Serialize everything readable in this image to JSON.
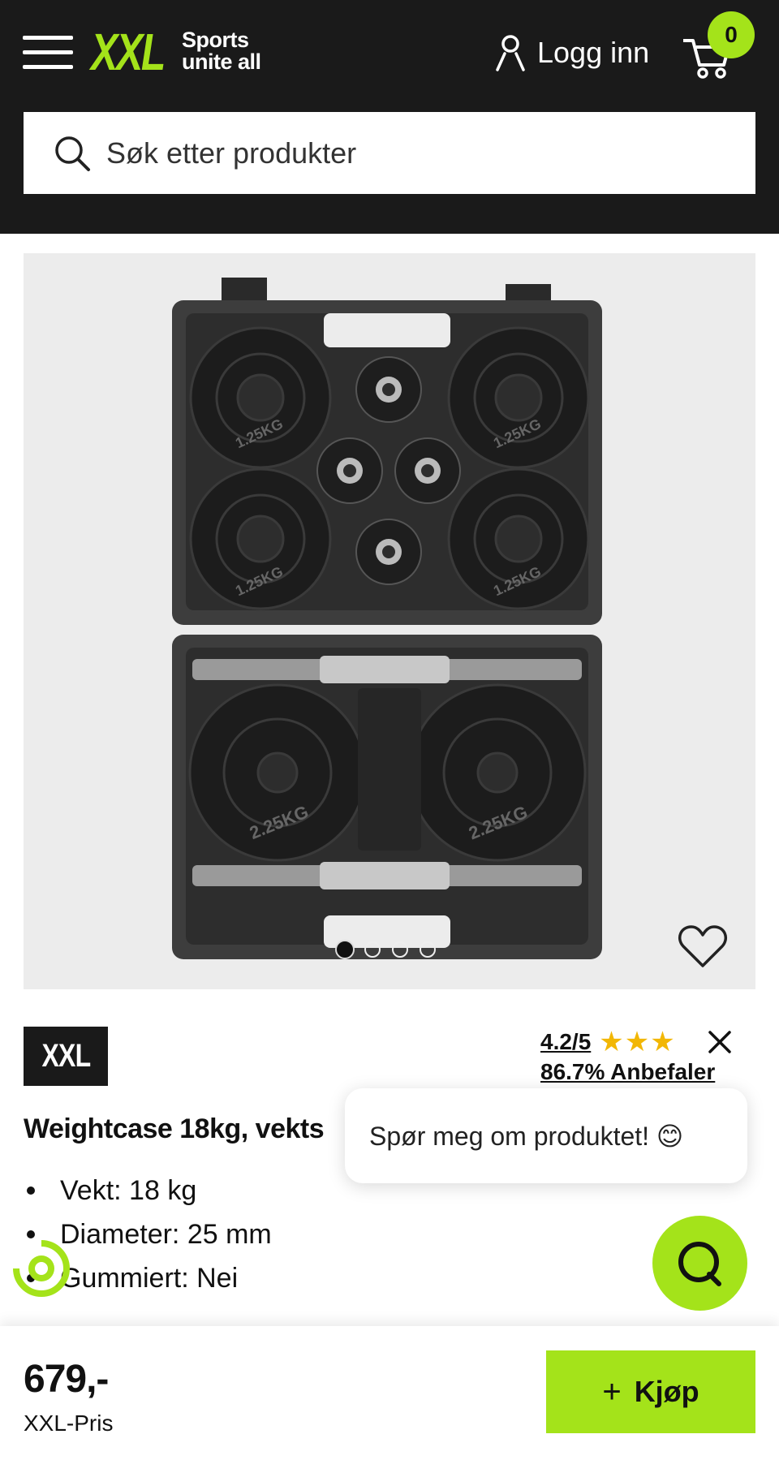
{
  "header": {
    "logo_text": "XXL",
    "logo_tagline_1": "Sports",
    "logo_tagline_2": "unite all",
    "login_label": "Logg inn",
    "cart_count": "0",
    "search_placeholder": "Søk etter produkter",
    "accent_color": "#a4e31a"
  },
  "gallery": {
    "image_count": 4,
    "active_index": 0,
    "plate_small_label": "1.25KG",
    "plate_large_label": "2.25KG"
  },
  "product": {
    "brand_logo": "XXL",
    "rating_score": "4.2/5",
    "stars": "★★★",
    "recommend": "86.7% Anbefaler",
    "title": "Weightcase 18kg, vekts",
    "specs": [
      "Vekt: 18 kg",
      "Diameter: 25 mm",
      "Gummiert: Nei"
    ]
  },
  "chat": {
    "bubble_text": "Spør meg om produktet! 😊"
  },
  "bottom": {
    "price": "679,-",
    "price_label": "XXL-Pris",
    "buy_label": "Kjøp"
  }
}
